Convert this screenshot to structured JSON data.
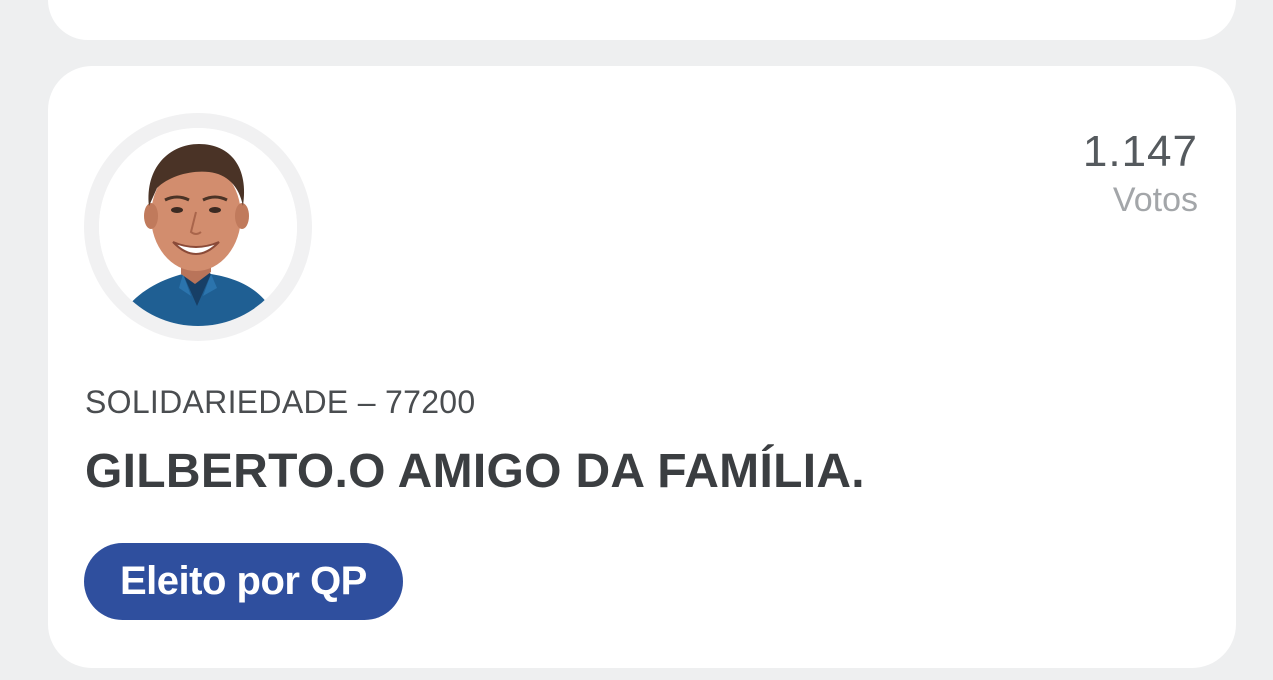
{
  "candidate": {
    "votes_count": "1.147",
    "votes_label": "Votos",
    "party_number": "SOLIDARIEDADE – 77200",
    "name": "GILBERTO.O AMIGO DA FAMÍLIA.",
    "status": "Eleito por QP"
  },
  "colors": {
    "background": "#eeeff0",
    "card": "#ffffff",
    "badge": "#2f4f9e",
    "votes_count": "#555a5e",
    "votes_label": "#a3a6a9",
    "name": "#3b3e41"
  }
}
